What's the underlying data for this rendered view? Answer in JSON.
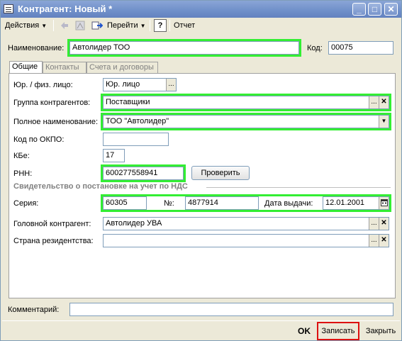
{
  "window": {
    "title": "Контрагент: Новый *",
    "controls": {
      "minimize": "_",
      "maximize": "□",
      "close": "✕"
    }
  },
  "toolbar": {
    "actions_label": "Действия",
    "goto_label": "Перейти",
    "help_label": "?",
    "report_label": "Отчет"
  },
  "header": {
    "name_label": "Наименование:",
    "name_value": "Автолидер ТОО",
    "code_label": "Код:",
    "code_value": "00075"
  },
  "tabs": [
    {
      "label": "Общие",
      "active": true
    },
    {
      "label": "Контакты",
      "active": false
    },
    {
      "label": "Счета и договоры",
      "active": false
    }
  ],
  "form": {
    "legal_label": "Юр. / физ. лицо:",
    "legal_value": "Юр. лицо",
    "group_label": "Группа контрагентов:",
    "group_value": "Поставщики",
    "fullname_label": "Полное наименование:",
    "fullname_value": "ТОО \"Автолидер\"",
    "okpo_label": "Код по ОКПО:",
    "okpo_value": "",
    "kbe_label": "КБе:",
    "kbe_value": "17",
    "rnn_label": "РНН:",
    "rnn_value": "600277558941",
    "check_button": "Проверить",
    "vat_section": "Свидетельство о постановке на учет по НДС",
    "series_label": "Серия:",
    "series_value": "60305",
    "number_label": "№:",
    "number_value": "4877914",
    "issue_date_label": "Дата выдачи:",
    "issue_date_value": "12.01.2001",
    "parent_label": "Головной контрагент:",
    "parent_value": "Автолидер УВА",
    "country_label": "Страна резидентства:",
    "country_value": ""
  },
  "comment": {
    "label": "Комментарий:",
    "value": ""
  },
  "footer": {
    "ok_label": "OK",
    "save_label": "Записать",
    "close_label": "Закрыть"
  },
  "colors": {
    "highlight_green": "#33ee33",
    "highlight_red": "#dd1111",
    "titlebar": "#7894cb"
  }
}
